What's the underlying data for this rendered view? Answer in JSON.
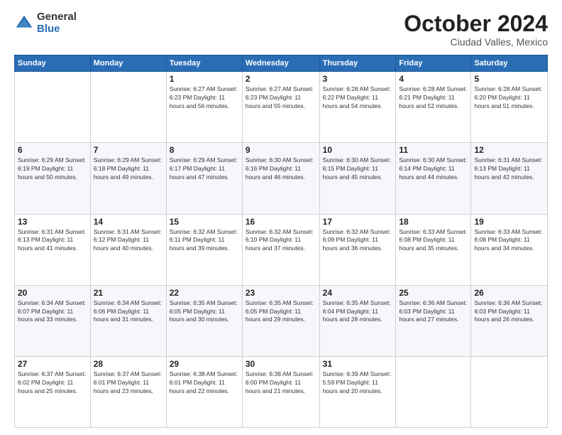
{
  "header": {
    "logo_general": "General",
    "logo_blue": "Blue",
    "month": "October 2024",
    "location": "Ciudad Valles, Mexico"
  },
  "days_of_week": [
    "Sunday",
    "Monday",
    "Tuesday",
    "Wednesday",
    "Thursday",
    "Friday",
    "Saturday"
  ],
  "weeks": [
    [
      {
        "day": "",
        "info": ""
      },
      {
        "day": "",
        "info": ""
      },
      {
        "day": "1",
        "info": "Sunrise: 6:27 AM\nSunset: 6:23 PM\nDaylight: 11 hours and 56 minutes."
      },
      {
        "day": "2",
        "info": "Sunrise: 6:27 AM\nSunset: 6:23 PM\nDaylight: 11 hours and 55 minutes."
      },
      {
        "day": "3",
        "info": "Sunrise: 6:28 AM\nSunset: 6:22 PM\nDaylight: 11 hours and 54 minutes."
      },
      {
        "day": "4",
        "info": "Sunrise: 6:28 AM\nSunset: 6:21 PM\nDaylight: 11 hours and 52 minutes."
      },
      {
        "day": "5",
        "info": "Sunrise: 6:28 AM\nSunset: 6:20 PM\nDaylight: 11 hours and 51 minutes."
      }
    ],
    [
      {
        "day": "6",
        "info": "Sunrise: 6:29 AM\nSunset: 6:19 PM\nDaylight: 11 hours and 50 minutes."
      },
      {
        "day": "7",
        "info": "Sunrise: 6:29 AM\nSunset: 6:18 PM\nDaylight: 11 hours and 49 minutes."
      },
      {
        "day": "8",
        "info": "Sunrise: 6:29 AM\nSunset: 6:17 PM\nDaylight: 11 hours and 47 minutes."
      },
      {
        "day": "9",
        "info": "Sunrise: 6:30 AM\nSunset: 6:16 PM\nDaylight: 11 hours and 46 minutes."
      },
      {
        "day": "10",
        "info": "Sunrise: 6:30 AM\nSunset: 6:15 PM\nDaylight: 11 hours and 45 minutes."
      },
      {
        "day": "11",
        "info": "Sunrise: 6:30 AM\nSunset: 6:14 PM\nDaylight: 11 hours and 44 minutes."
      },
      {
        "day": "12",
        "info": "Sunrise: 6:31 AM\nSunset: 6:13 PM\nDaylight: 11 hours and 42 minutes."
      }
    ],
    [
      {
        "day": "13",
        "info": "Sunrise: 6:31 AM\nSunset: 6:13 PM\nDaylight: 11 hours and 41 minutes."
      },
      {
        "day": "14",
        "info": "Sunrise: 6:31 AM\nSunset: 6:12 PM\nDaylight: 11 hours and 40 minutes."
      },
      {
        "day": "15",
        "info": "Sunrise: 6:32 AM\nSunset: 6:11 PM\nDaylight: 11 hours and 39 minutes."
      },
      {
        "day": "16",
        "info": "Sunrise: 6:32 AM\nSunset: 6:10 PM\nDaylight: 11 hours and 37 minutes."
      },
      {
        "day": "17",
        "info": "Sunrise: 6:32 AM\nSunset: 6:09 PM\nDaylight: 11 hours and 36 minutes."
      },
      {
        "day": "18",
        "info": "Sunrise: 6:33 AM\nSunset: 6:08 PM\nDaylight: 11 hours and 35 minutes."
      },
      {
        "day": "19",
        "info": "Sunrise: 6:33 AM\nSunset: 6:08 PM\nDaylight: 11 hours and 34 minutes."
      }
    ],
    [
      {
        "day": "20",
        "info": "Sunrise: 6:34 AM\nSunset: 6:07 PM\nDaylight: 11 hours and 33 minutes."
      },
      {
        "day": "21",
        "info": "Sunrise: 6:34 AM\nSunset: 6:06 PM\nDaylight: 11 hours and 31 minutes."
      },
      {
        "day": "22",
        "info": "Sunrise: 6:35 AM\nSunset: 6:05 PM\nDaylight: 11 hours and 30 minutes."
      },
      {
        "day": "23",
        "info": "Sunrise: 6:35 AM\nSunset: 6:05 PM\nDaylight: 11 hours and 29 minutes."
      },
      {
        "day": "24",
        "info": "Sunrise: 6:35 AM\nSunset: 6:04 PM\nDaylight: 11 hours and 28 minutes."
      },
      {
        "day": "25",
        "info": "Sunrise: 6:36 AM\nSunset: 6:03 PM\nDaylight: 11 hours and 27 minutes."
      },
      {
        "day": "26",
        "info": "Sunrise: 6:36 AM\nSunset: 6:03 PM\nDaylight: 11 hours and 26 minutes."
      }
    ],
    [
      {
        "day": "27",
        "info": "Sunrise: 6:37 AM\nSunset: 6:02 PM\nDaylight: 11 hours and 25 minutes."
      },
      {
        "day": "28",
        "info": "Sunrise: 6:37 AM\nSunset: 6:01 PM\nDaylight: 11 hours and 23 minutes."
      },
      {
        "day": "29",
        "info": "Sunrise: 6:38 AM\nSunset: 6:01 PM\nDaylight: 11 hours and 22 minutes."
      },
      {
        "day": "30",
        "info": "Sunrise: 6:38 AM\nSunset: 6:00 PM\nDaylight: 11 hours and 21 minutes."
      },
      {
        "day": "31",
        "info": "Sunrise: 6:39 AM\nSunset: 5:59 PM\nDaylight: 11 hours and 20 minutes."
      },
      {
        "day": "",
        "info": ""
      },
      {
        "day": "",
        "info": ""
      }
    ]
  ]
}
